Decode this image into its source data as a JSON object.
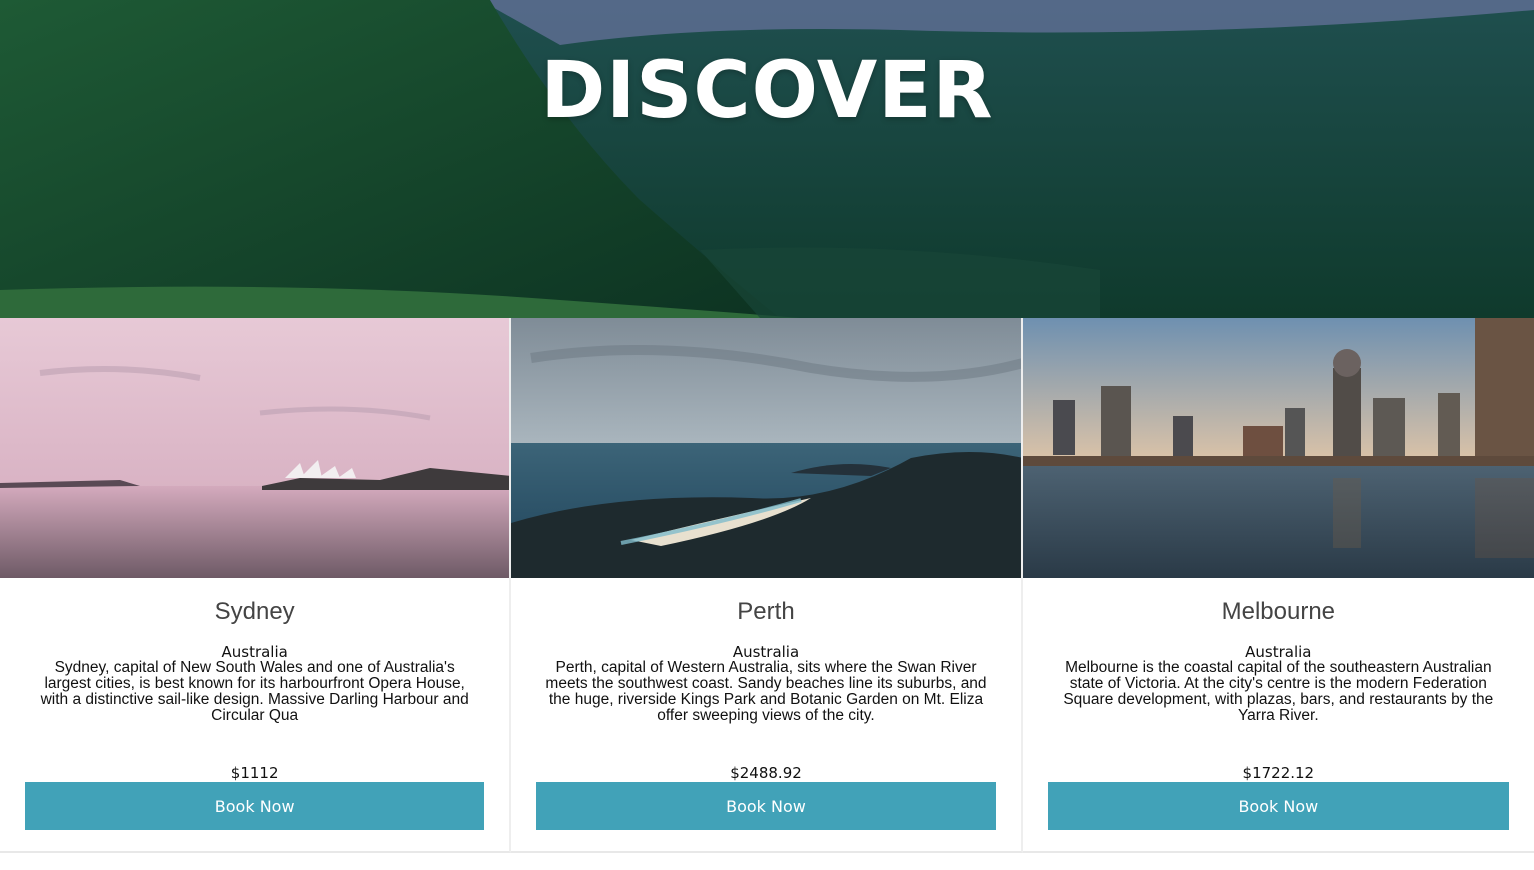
{
  "hero": {
    "title": "DISCOVER"
  },
  "colors": {
    "button": "#41a2b8",
    "hero_dark": "#17402c"
  },
  "destinations": [
    {
      "name": "Sydney",
      "country": "Australia",
      "description": "Sydney, capital of New South Wales and one of Australia's largest cities, is best known for its harbourfront Opera House, with a distinctive sail-like design. Massive Darling Harbour and Circular Qua",
      "price": "$1112",
      "button_label": "Book Now"
    },
    {
      "name": "Perth",
      "country": "Australia",
      "description": "Perth, capital of Western Australia, sits where the Swan River meets the southwest coast. Sandy beaches line its suburbs, and the huge, riverside Kings Park and Botanic Garden on Mt. Eliza offer sweeping views of the city.",
      "price": "$2488.92",
      "button_label": "Book Now"
    },
    {
      "name": "Melbourne",
      "country": "Australia",
      "description": "Melbourne is the coastal capital of the southeastern Australian state of Victoria. At the city's centre is the modern Federation Square development, with plazas, bars, and restaurants by the Yarra River.",
      "price": "$1722.12",
      "button_label": "Book Now"
    }
  ]
}
